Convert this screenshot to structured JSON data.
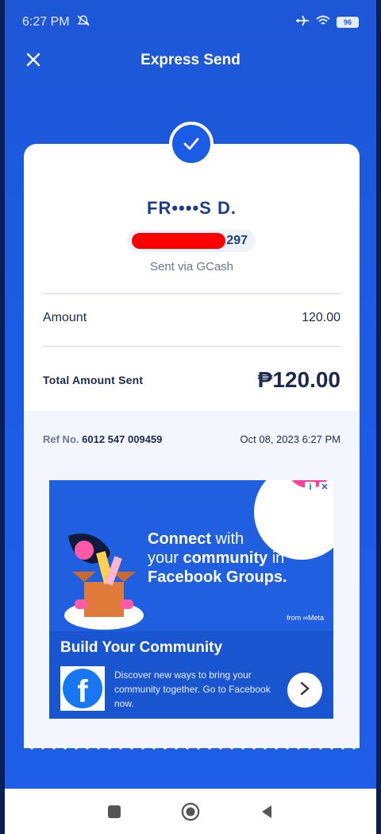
{
  "status_bar": {
    "time": "6:27 PM",
    "battery": "96"
  },
  "header": {
    "title": "Express Send"
  },
  "receipt": {
    "recipient_name": "FR••••S D.",
    "account_tail": "297",
    "sent_via": "Sent via GCash",
    "amount_label": "Amount",
    "amount_value": "120.00",
    "total_label": "Total Amount Sent",
    "total_value": "₱120.00",
    "ref_label": "Ref No.",
    "ref_value": "6012 547 009459",
    "datetime": "Oct 08, 2023 6:27 PM"
  },
  "ad": {
    "headline_1": "Connect",
    "headline_2": " with",
    "headline_3": "your ",
    "headline_4": "community",
    "headline_5": " in",
    "headline_6": "Facebook Groups.",
    "meta_mark": "from ∞Meta",
    "title": "Build Your Community",
    "body": "Discover new ways to bring your community together. Go to Facebook now.",
    "cta_icon": "chevron-right",
    "brand_icon": "facebook-logo"
  },
  "colors": {
    "primary_blue": "#1a5ce6",
    "dark_text": "#1b2a4e",
    "redaction": "#ff0000"
  }
}
